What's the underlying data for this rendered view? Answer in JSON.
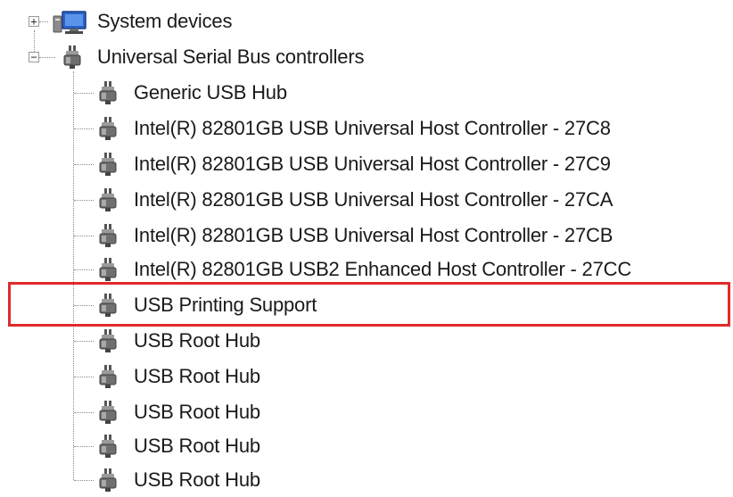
{
  "tree": {
    "system_devices": "System devices",
    "usb_controllers": "Universal Serial Bus controllers",
    "expand_glyph": "+",
    "collapse_glyph": "−",
    "devices": [
      "Generic USB Hub",
      "Intel(R) 82801GB USB Universal Host Controller - 27C8",
      "Intel(R) 82801GB USB Universal Host Controller - 27C9",
      "Intel(R) 82801GB USB Universal Host Controller - 27CA",
      "Intel(R) 82801GB USB Universal Host Controller - 27CB",
      "Intel(R) 82801GB USB2 Enhanced Host Controller - 27CC",
      "USB Printing Support",
      "USB Root Hub",
      "USB Root Hub",
      "USB Root Hub",
      "USB Root Hub",
      "USB Root Hub"
    ],
    "highlighted_device": "USB Printing Support",
    "highlight_color": "#e12a2a"
  }
}
